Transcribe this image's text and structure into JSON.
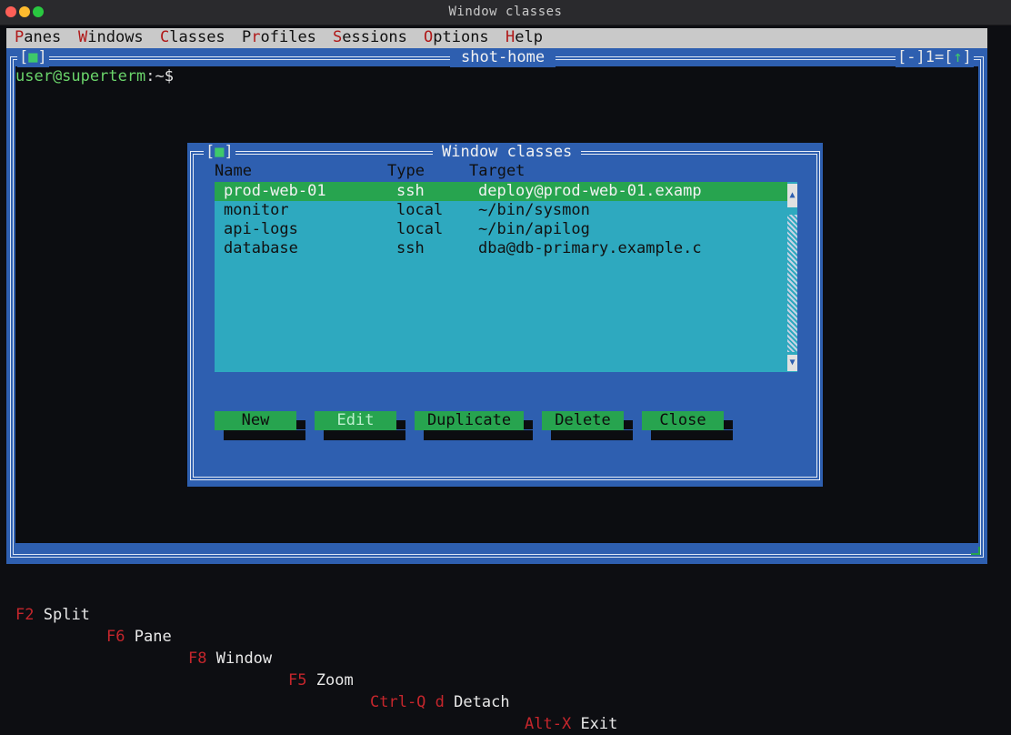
{
  "app": {
    "window_title": "Window classes"
  },
  "menu": [
    {
      "key": "P",
      "rest": "anes"
    },
    {
      "key": "W",
      "rest": "indows"
    },
    {
      "key": "C",
      "rest": "lasses"
    },
    {
      "key": "P",
      "rest": "r",
      "tail": "ofiles",
      "hotkey_index": 1
    },
    {
      "key": "S",
      "rest": "essions"
    },
    {
      "key": "O",
      "rest": "ptions"
    },
    {
      "key": "H",
      "rest": "elp"
    }
  ],
  "main_window": {
    "title": "shot-home",
    "left_marker": "[■]",
    "right_controls": "[-]1=[↑]",
    "close_glyph": "■",
    "up_glyph": "↑"
  },
  "terminal": {
    "user_host": "user@superterm",
    "path": ":~",
    "prompt": "$"
  },
  "dialog": {
    "title": "Window classes",
    "close_glyph": "■",
    "columns": [
      "Name",
      "Type",
      "Target"
    ],
    "rows": [
      {
        "name": "prod-web-01",
        "type": "ssh",
        "target": "deploy@prod-web-01.examp",
        "selected": true
      },
      {
        "name": "monitor",
        "type": "local",
        "target": "~/bin/sysmon",
        "selected": false
      },
      {
        "name": "api-logs",
        "type": "local",
        "target": "~/bin/apilog",
        "selected": false
      },
      {
        "name": "database",
        "type": "ssh",
        "target": "dba@db-primary.example.c",
        "selected": false
      }
    ],
    "buttons": {
      "new": "New",
      "edit": "Edit",
      "duplicate": "Duplicate",
      "delete": "Delete",
      "close": "Close"
    },
    "scroll_up": "▲",
    "scroll_down": "▼"
  },
  "status_bar": [
    {
      "key": "F2",
      "label": "Split"
    },
    {
      "key": "F6",
      "label": "Pane"
    },
    {
      "key": "F8",
      "label": "Window"
    },
    {
      "key": "F5",
      "label": "Zoom"
    },
    {
      "key": "Ctrl-Q d",
      "label": "Detach"
    },
    {
      "key": "Alt-X",
      "label": "Exit"
    }
  ],
  "colors": {
    "frame_blue": "#2e5fb0",
    "list_cyan": "#2ea9bf",
    "selection_green": "#27a44f",
    "hotkey_red": "#c5262c",
    "prompt_green": "#6ad46a"
  }
}
